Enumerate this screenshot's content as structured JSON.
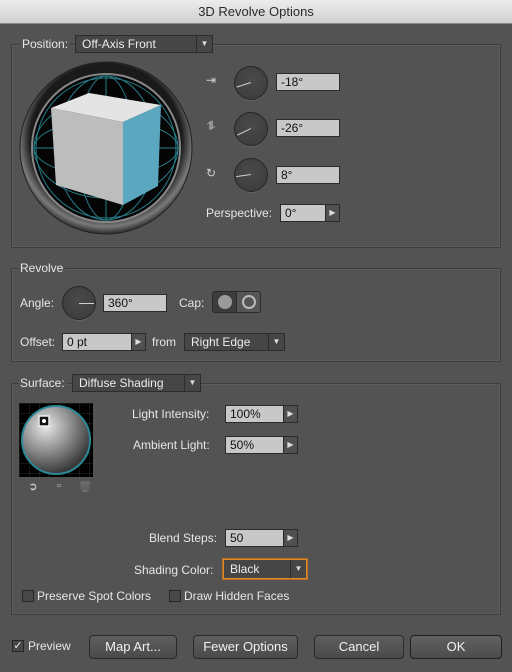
{
  "window": {
    "title": "3D Revolve Options"
  },
  "position": {
    "label": "Position:",
    "preset": "Off-Axis Front",
    "x_rotation": "-18°",
    "y_rotation": "-26°",
    "z_rotation": "8°",
    "perspective_label": "Perspective:",
    "perspective": "0°"
  },
  "revolve": {
    "group_label": "Revolve",
    "angle_label": "Angle:",
    "angle": "360°",
    "cap_label": "Cap:",
    "offset_label": "Offset:",
    "offset": "0 pt",
    "from_label": "from",
    "from": "Right Edge"
  },
  "surface": {
    "label": "Surface:",
    "value": "Diffuse Shading",
    "light_intensity_label": "Light Intensity:",
    "light_intensity": "100%",
    "ambient_light_label": "Ambient Light:",
    "ambient_light": "50%",
    "blend_steps_label": "Blend Steps:",
    "blend_steps": "50",
    "shading_color_label": "Shading Color:",
    "shading_color": "Black",
    "preserve_spot_colors": "Preserve Spot Colors",
    "draw_hidden_faces": "Draw Hidden Faces"
  },
  "footer": {
    "preview_label": "Preview",
    "preview_checked": true,
    "map_art": "Map Art...",
    "fewer_options": "Fewer Options",
    "cancel": "Cancel",
    "ok": "OK"
  },
  "colors": {
    "cube_front": "#5aa7bf",
    "focus_orange": "#d98a2b",
    "background": "#535353"
  }
}
